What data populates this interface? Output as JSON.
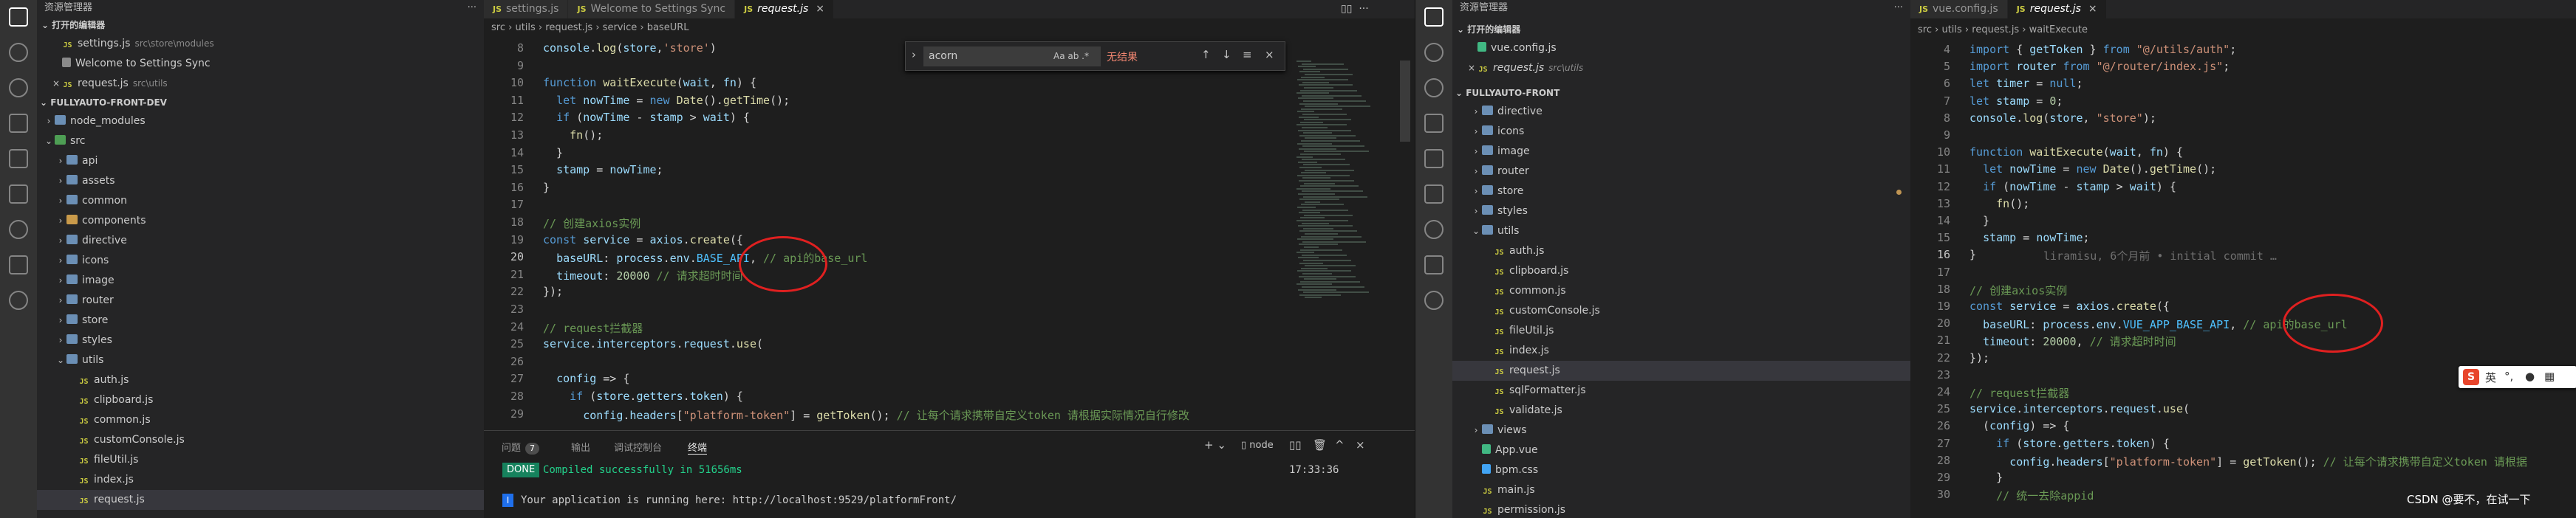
{
  "left": {
    "explorer_title": "资源管理器",
    "open_editors_label": "打开的编辑器",
    "open_editors": [
      {
        "name": "settings.js",
        "desc": "src\\store\\modules",
        "type": "js",
        "selected": false
      },
      {
        "name": "Welcome to Settings Sync",
        "desc": "",
        "type": "settings",
        "selected": false
      },
      {
        "name": "request.js",
        "desc": "src\\utils",
        "type": "js",
        "selected": false,
        "close": true
      }
    ],
    "project_label": "FULLYAUTO-FRONT-DEV",
    "tree": [
      {
        "name": "node_modules",
        "type": "folder",
        "depth": 1
      },
      {
        "name": "src",
        "type": "folder-green",
        "depth": 1,
        "open": true
      },
      {
        "name": "api",
        "type": "folder",
        "depth": 2
      },
      {
        "name": "assets",
        "type": "folder",
        "depth": 2
      },
      {
        "name": "common",
        "type": "folder",
        "depth": 2
      },
      {
        "name": "components",
        "type": "folder-orange",
        "depth": 2
      },
      {
        "name": "directive",
        "type": "folder",
        "depth": 2
      },
      {
        "name": "icons",
        "type": "folder",
        "depth": 2
      },
      {
        "name": "image",
        "type": "folder",
        "depth": 2
      },
      {
        "name": "router",
        "type": "folder",
        "depth": 2
      },
      {
        "name": "store",
        "type": "folder",
        "depth": 2
      },
      {
        "name": "styles",
        "type": "folder",
        "depth": 2
      },
      {
        "name": "utils",
        "type": "folder",
        "depth": 2,
        "open": true
      },
      {
        "name": "auth.js",
        "type": "js",
        "depth": 3
      },
      {
        "name": "clipboard.js",
        "type": "js",
        "depth": 3
      },
      {
        "name": "common.js",
        "type": "js",
        "depth": 3
      },
      {
        "name": "customConsole.js",
        "type": "js",
        "depth": 3
      },
      {
        "name": "fileUtil.js",
        "type": "js",
        "depth": 3
      },
      {
        "name": "index.js",
        "type": "js",
        "depth": 3
      },
      {
        "name": "request.js",
        "type": "js",
        "depth": 3,
        "selected": true
      }
    ],
    "tabs": [
      {
        "label": "settings.js",
        "active": false
      },
      {
        "label": "Welcome to Settings Sync",
        "active": false
      },
      {
        "label": "request.js",
        "active": true
      }
    ],
    "breadcrumb": [
      "src",
      "utils",
      "request.js",
      "service",
      "baseURL"
    ],
    "find": {
      "value": "acorn",
      "opts": "Aa  ab  .*",
      "result": "无结果"
    },
    "code_lines": [
      {
        "n": "8",
        "html": "console.log(store,'store')"
      },
      {
        "n": "9",
        "html": ""
      },
      {
        "n": "10",
        "html": "function waitExecute(wait, fn) {"
      },
      {
        "n": "11",
        "html": "  let nowTime = new Date().getTime();"
      },
      {
        "n": "12",
        "html": "  if (nowTime - stamp > wait) {"
      },
      {
        "n": "13",
        "html": "    fn();"
      },
      {
        "n": "14",
        "html": "  }"
      },
      {
        "n": "15",
        "html": "  stamp = nowTime;"
      },
      {
        "n": "16",
        "html": "}"
      },
      {
        "n": "17",
        "html": ""
      },
      {
        "n": "18",
        "html": "// 创建axios实例"
      },
      {
        "n": "19",
        "html": "const service = axios.create({"
      },
      {
        "n": "20",
        "html": "  baseURL: process.env.BASE_API, // api的base_url"
      },
      {
        "n": "21",
        "html": "  timeout: 20000 // 请求超时时间"
      },
      {
        "n": "22",
        "html": "});"
      },
      {
        "n": "23",
        "html": ""
      },
      {
        "n": "24",
        "html": "// request拦截器"
      },
      {
        "n": "25",
        "html": "service.interceptors.request.use("
      },
      {
        "n": "26",
        "html": ""
      },
      {
        "n": "27",
        "html": "  config => {"
      },
      {
        "n": "28",
        "html": "    if (store.getters.token) {"
      },
      {
        "n": "29",
        "html": "      config.headers[\"platform-token\"] = getToken(); // 让每个请求携带自定义token 请根据实际情况自行修改"
      }
    ],
    "panel": {
      "tabs": [
        "问题",
        "输出",
        "调试控制台",
        "终端"
      ],
      "problems_count": "7",
      "active_tab": "终端",
      "terminal_name": "node",
      "done": "DONE",
      "compiled": "Compiled successfully in 51656ms",
      "time": "17:33:36",
      "info_badge": "I",
      "running": "Your application is running here: http://localhost:9529/platformFront/"
    }
  },
  "right": {
    "explorer_title": "资源管理器",
    "open_editors_label": "打开的编辑器",
    "open_editors": [
      {
        "name": "vue.config.js",
        "desc": "",
        "type": "vue",
        "selected": false
      },
      {
        "name": "request.js",
        "desc": "src\\utils",
        "type": "js",
        "selected": false,
        "close": true,
        "italic": true
      }
    ],
    "project_label": "FULLYAUTO-FRONT",
    "tree": [
      {
        "name": "directive",
        "type": "folder",
        "depth": 2
      },
      {
        "name": "icons",
        "type": "folder",
        "depth": 2
      },
      {
        "name": "image",
        "type": "folder",
        "depth": 2
      },
      {
        "name": "router",
        "type": "folder",
        "depth": 2
      },
      {
        "name": "store",
        "type": "folder",
        "depth": 2,
        "modified": true
      },
      {
        "name": "styles",
        "type": "folder",
        "depth": 2
      },
      {
        "name": "utils",
        "type": "folder",
        "depth": 2,
        "open": true
      },
      {
        "name": "auth.js",
        "type": "js",
        "depth": 3
      },
      {
        "name": "clipboard.js",
        "type": "js",
        "depth": 3
      },
      {
        "name": "common.js",
        "type": "js",
        "depth": 3
      },
      {
        "name": "customConsole.js",
        "type": "js",
        "depth": 3
      },
      {
        "name": "fileUtil.js",
        "type": "js",
        "depth": 3
      },
      {
        "name": "index.js",
        "type": "js",
        "depth": 3
      },
      {
        "name": "request.js",
        "type": "js",
        "depth": 3,
        "selected": true
      },
      {
        "name": "sqlFormatter.js",
        "type": "js",
        "depth": 3
      },
      {
        "name": "validate.js",
        "type": "js",
        "depth": 3
      },
      {
        "name": "views",
        "type": "folder",
        "depth": 2
      },
      {
        "name": "App.vue",
        "type": "vue",
        "depth": 2
      },
      {
        "name": "bpm.css",
        "type": "css",
        "depth": 2
      },
      {
        "name": "main.js",
        "type": "js",
        "depth": 2
      },
      {
        "name": "permission.js",
        "type": "js",
        "depth": 2
      }
    ],
    "tabs": [
      {
        "label": "vue.config.js",
        "active": false
      },
      {
        "label": "request.js",
        "active": true
      }
    ],
    "breadcrumb": [
      "src",
      "utils",
      "request.js",
      "waitExecute"
    ],
    "code_lines": [
      {
        "n": "4",
        "html": "import { getToken } from \"@/utils/auth\";"
      },
      {
        "n": "5",
        "html": "import router from \"@/router/index.js\";"
      },
      {
        "n": "6",
        "html": "let timer = null;"
      },
      {
        "n": "7",
        "html": "let stamp = 0;"
      },
      {
        "n": "8",
        "html": "console.log(store, \"store\");"
      },
      {
        "n": "9",
        "html": ""
      },
      {
        "n": "10",
        "html": "function waitExecute(wait, fn) {"
      },
      {
        "n": "11",
        "html": "  let nowTime = new Date().getTime();"
      },
      {
        "n": "12",
        "html": "  if (nowTime - stamp > wait) {"
      },
      {
        "n": "13",
        "html": "    fn();"
      },
      {
        "n": "14",
        "html": "  }"
      },
      {
        "n": "15",
        "html": "  stamp = nowTime;"
      },
      {
        "n": "16",
        "html": "}"
      },
      {
        "n": "17",
        "html": ""
      },
      {
        "n": "18",
        "html": "// 创建axios实例"
      },
      {
        "n": "19",
        "html": "const service = axios.create({"
      },
      {
        "n": "20",
        "html": "  baseURL: process.env.VUE_APP_BASE_API, // api的base_url"
      },
      {
        "n": "21",
        "html": "  timeout: 20000, // 请求超时时间"
      },
      {
        "n": "22",
        "html": "});"
      },
      {
        "n": "23",
        "html": ""
      },
      {
        "n": "24",
        "html": "// request拦截器"
      },
      {
        "n": "25",
        "html": "service.interceptors.request.use("
      },
      {
        "n": "26",
        "html": "  (config) => {"
      },
      {
        "n": "27",
        "html": "    if (store.getters.token) {"
      },
      {
        "n": "28",
        "html": "      config.headers[\"platform-token\"] = getToken(); // 让每个请求携带自定义token 请根据"
      },
      {
        "n": "29",
        "html": "    }"
      },
      {
        "n": "30",
        "html": "    // 统一去除appid"
      }
    ],
    "blame": "liramisu, 6个月前 • initial commit …",
    "ime_label": "英",
    "watermark": "CSDN @要不，在试一下"
  },
  "colors": {
    "accent": "#007acc",
    "annotation": "#e02020",
    "done": "#16825d"
  }
}
